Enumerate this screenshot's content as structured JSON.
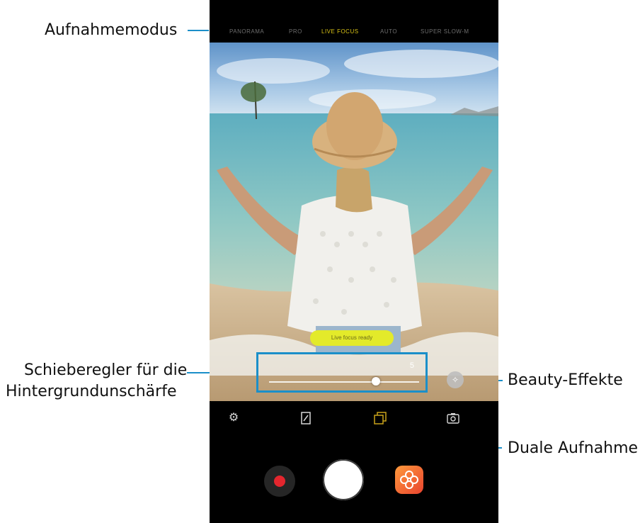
{
  "callouts": {
    "shooting_mode": "Aufnahmemodus",
    "blur_slider_line1": "Schieberegler für die",
    "blur_slider_line2": "Hintergrundunschärfe",
    "beauty_effects": "Beauty-Effekte",
    "dual_capture": "Duale Aufnahme"
  },
  "camera": {
    "modes": [
      "PANORAMA",
      "PRO",
      "LIVE FOCUS",
      "AUTO",
      "SUPER SLOW-M"
    ],
    "active_mode": "LIVE FOCUS",
    "live_focus_hint": "Live focus ready",
    "blur_level": 5,
    "blur_level_max": 7,
    "toolbar_icons": [
      "gear-icon",
      "aspect-ratio-icon",
      "dual-capture-icon",
      "switch-camera-icon"
    ],
    "bottom_controls": [
      "record-button",
      "shutter-button",
      "gallery-button"
    ],
    "colors": {
      "accent": "#1b8fc9",
      "active_mode": "#d9c316",
      "record": "#e4262e",
      "live_focus_pill": "#e3ea2a",
      "dual_capture_icon": "#c9a21a"
    }
  }
}
